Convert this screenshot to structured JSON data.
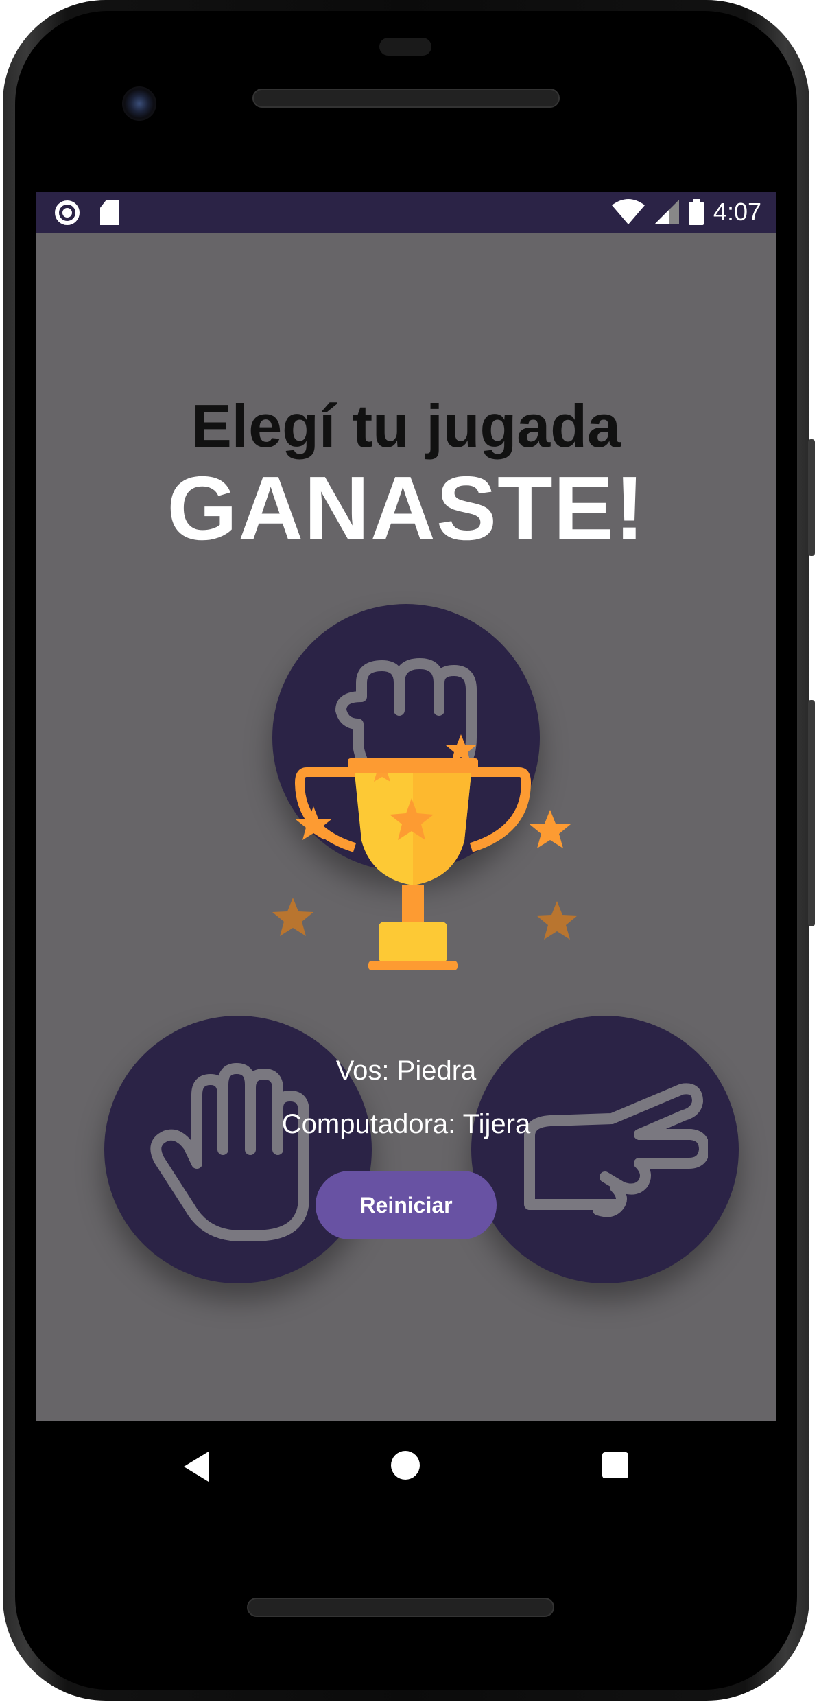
{
  "status_bar": {
    "time": "4:07",
    "left_icons": [
      "record-icon",
      "sd-card-icon"
    ],
    "right_icons": [
      "wifi-icon",
      "signal-icon",
      "battery-icon"
    ]
  },
  "game": {
    "title": "Elegí tu jugada",
    "result": "GANASTE!",
    "options": [
      {
        "name": "Piedra",
        "icon": "rock-fist-icon"
      },
      {
        "name": "Papel",
        "icon": "paper-hand-icon"
      },
      {
        "name": "Tijera",
        "icon": "scissors-hand-icon"
      }
    ],
    "player_line": "Vos: Piedra",
    "computer_line": "Computadora: Tijera",
    "restart_label": "Reiniciar",
    "trophy_icon": "trophy-icon"
  },
  "nav_bar": {
    "buttons": [
      "back-icon",
      "home-icon",
      "recents-icon"
    ]
  },
  "colors": {
    "background": "#676568",
    "status_bar": "#2b2346",
    "circle": "#2b2346",
    "button": "#6852a3",
    "trophy_gold": "#fdc935",
    "trophy_orange": "#fd9b32"
  }
}
